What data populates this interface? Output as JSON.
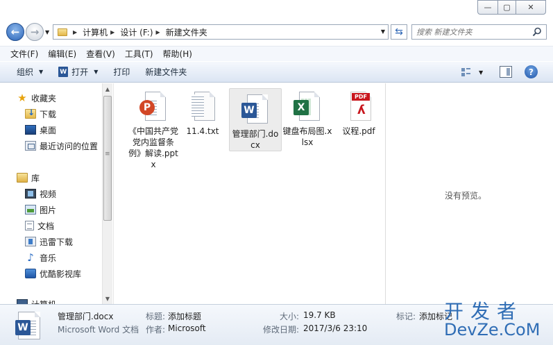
{
  "window": {
    "minimize_glyph": "—",
    "maximize_glyph": "▢",
    "close_glyph": "✕"
  },
  "address": {
    "crumbs": [
      "计算机",
      "设计 (F:)",
      "新建文件夹"
    ],
    "search_placeholder": "搜索 新建文件夹"
  },
  "menu": [
    "文件(F)",
    "编辑(E)",
    "查看(V)",
    "工具(T)",
    "帮助(H)"
  ],
  "toolbar": {
    "organize": "组织",
    "open": "打开",
    "print": "打印",
    "new_folder": "新建文件夹",
    "help": "?"
  },
  "nav": {
    "favorites": {
      "label": "收藏夹",
      "items": [
        "下载",
        "桌面",
        "最近访问的位置"
      ]
    },
    "libraries": {
      "label": "库",
      "items": [
        "视频",
        "图片",
        "文档",
        "迅雷下载",
        "音乐",
        "优酷影视库"
      ]
    },
    "computer": "计算机"
  },
  "files": [
    {
      "name": "《中国共产党党内监督条例》解读.pptx",
      "type": "pptx",
      "badge": "P",
      "selected": false
    },
    {
      "name": "11.4.txt",
      "type": "txt",
      "badge": "",
      "selected": false
    },
    {
      "name": "管理部门.docx",
      "type": "docx",
      "badge": "W",
      "selected": true
    },
    {
      "name": "键盘布局图.xlsx",
      "type": "xlsx",
      "badge": "X",
      "selected": false
    },
    {
      "name": "议程.pdf",
      "type": "pdf",
      "badge": "PDF",
      "selected": false
    }
  ],
  "preview": {
    "text": "没有预览。"
  },
  "details": {
    "filename": "管理部门.docx",
    "filetype": "Microsoft Word 文档",
    "title_label": "标题:",
    "title_value": "添加标题",
    "author_label": "作者:",
    "author_value": "Microsoft",
    "size_label": "大小:",
    "size_value": "19.7 KB",
    "modified_label": "修改日期:",
    "modified_value": "2017/3/6 23:10",
    "tags_label": "标记:",
    "tags_value": "添加标记"
  },
  "watermark": {
    "top": "开发者",
    "bottom": "DevZe.CoM"
  },
  "colors": {
    "accent": "#2b5797",
    "selection": "#ececec",
    "toolbar_top": "#f5f8fd",
    "toolbar_bottom": "#dbe5f3",
    "watermark": "#2f6db5"
  }
}
